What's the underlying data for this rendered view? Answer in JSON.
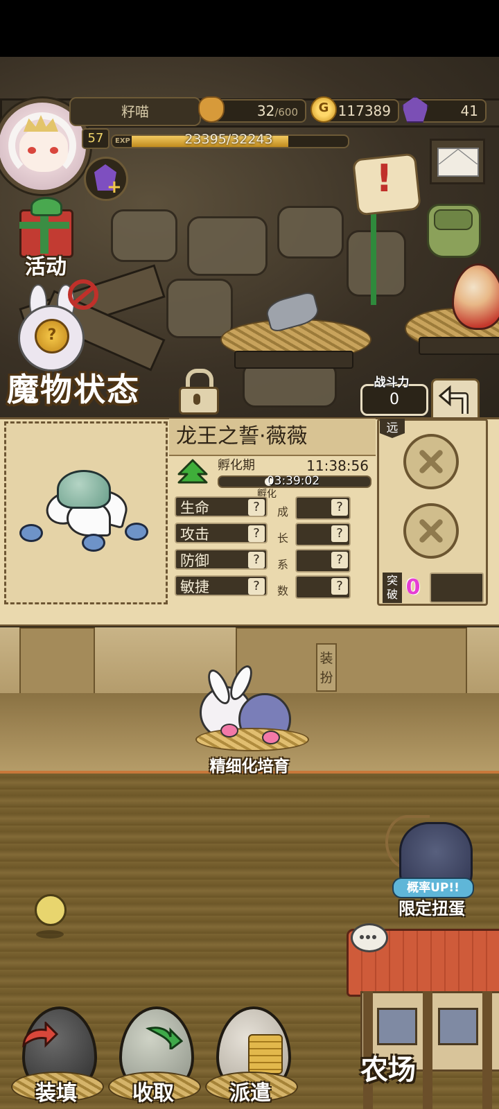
{
  "hud": {
    "player_name": "籽喵",
    "level": "57",
    "exp_label": "EXP",
    "exp_text": "23395/32243",
    "exp_current": 23395,
    "exp_max": 32243,
    "bread_current": "32",
    "bread_max": "/600",
    "gold": "117389",
    "gold_symbol": "G",
    "gems": "41"
  },
  "side_menu": {
    "activity_label": "活动"
  },
  "section": {
    "title": "魔物状态",
    "power_label": "战斗力",
    "power_value": "0"
  },
  "monster": {
    "name": "龙王之誓·薇薇",
    "hatch_label": "孵化期",
    "hatch_time": "11:38:56",
    "hatch_remaining": "03:39:02",
    "hatch_sub": "孵化",
    "hatch_progress": 0.32,
    "stats": [
      {
        "label": "生命",
        "value": "?",
        "growth": "?"
      },
      {
        "label": "攻击",
        "value": "?",
        "growth": "?"
      },
      {
        "label": "防御",
        "value": "?",
        "growth": "?"
      },
      {
        "label": "敏捷",
        "value": "?",
        "growth": "?"
      }
    ],
    "growth_chars": [
      "成",
      "长",
      "系",
      "数"
    ],
    "range_tag": "远",
    "break_label": "突破",
    "break_count": "0"
  },
  "scene": {
    "dress_label": "装扮",
    "nurture_label": "精细化培育",
    "rate_up_label": "概率UP!!",
    "limited_label": "限定扭蛋",
    "farm_label": "农场"
  },
  "bottom_nav": {
    "load_label": "装填",
    "collect_label": "收取",
    "dispatch_label": "派遣"
  },
  "colors": {
    "accent_gold": "#f2c960",
    "break_pink": "#e53ed3",
    "hatch_green": "#3fae3a"
  }
}
